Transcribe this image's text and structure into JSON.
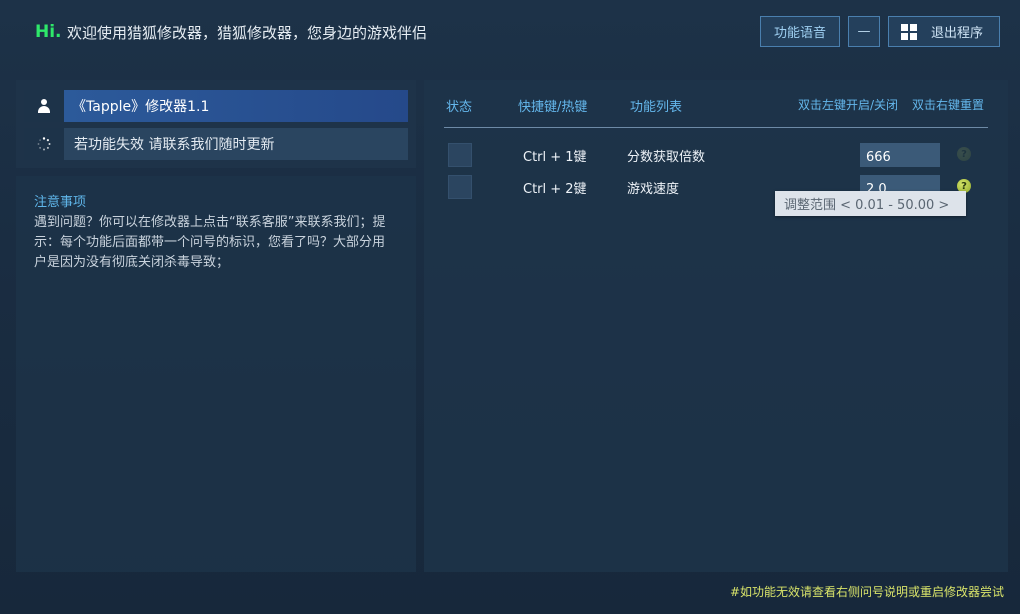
{
  "header": {
    "hi": "Hi.",
    "welcome": "欢迎使用猎狐修改器，猎狐修改器，您身边的游戏伴侣",
    "voice_button": "功能语音",
    "minimize_button": "—",
    "exit_button": "退出程序"
  },
  "sidebar": {
    "title_item": "《Tapple》修改器1.1",
    "update_item": "若功能失效  请联系我们随时更新"
  },
  "notice": {
    "title": "注意事项",
    "text": "遇到问题？你可以在修改器上点击“联系客服”来联系我们；提示：每个功能后面都带一个问号的标识，您看了吗？大部分用户是因为没有彻底关闭杀毒导致；"
  },
  "table": {
    "headers": {
      "status": "状态",
      "hotkey": "快捷键/热键",
      "list": "功能列表",
      "dbl_left": "双击左键开启/关闭",
      "dbl_right": "双击右键重置"
    },
    "rows": [
      {
        "hotkey": "Ctrl  +  1键",
        "name": "分数获取倍数",
        "value": "666"
      },
      {
        "hotkey": "Ctrl  +  2键",
        "name": "游戏速度",
        "value": "2.0"
      }
    ]
  },
  "tooltip": "调整范围 < 0.01 - 50.00 >",
  "footer": "#如功能无效请查看右侧问号说明或重启修改器尝试",
  "colors": {
    "accent_green": "#2ee86a",
    "header_blue": "#64b7ec",
    "footer_yellow": "#d9e46a"
  },
  "icons": {
    "user": "user-icon",
    "spinner": "loading-icon",
    "windows": "windows-icon",
    "help": "help-icon"
  }
}
